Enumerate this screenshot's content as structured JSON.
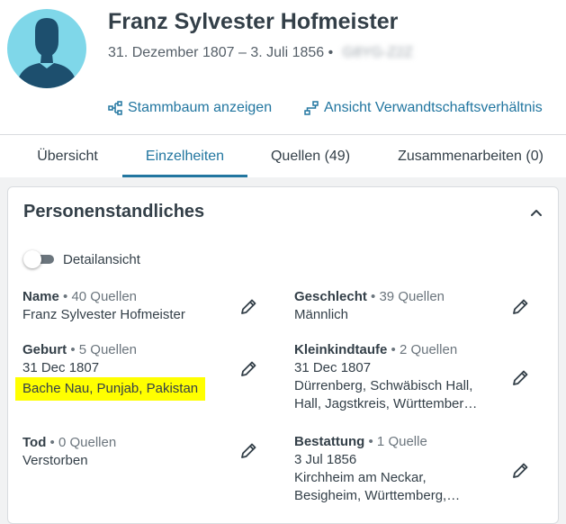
{
  "person": {
    "name": "Franz Sylvester Hofmeister",
    "dates": "31. Dezember 1807 – 3. Juli 1856 •",
    "id": "G8YG-Z2Z"
  },
  "actions": {
    "tree": "Stammbaum anzeigen",
    "relationship": "Ansicht Verwandtschaftsverhältnis"
  },
  "tabs": [
    {
      "label": "Übersicht"
    },
    {
      "label": "Einzelheiten"
    },
    {
      "label": "Quellen (49)"
    },
    {
      "label": "Zusammenarbeiten (0)"
    }
  ],
  "active_tab": "Einzelheiten",
  "section": {
    "title": "Personenstandliches",
    "toggle_label": "Detailansicht",
    "toggle_on": false
  },
  "fields": {
    "name": {
      "label": "Name",
      "sources": "• 40 Quellen",
      "lines": [
        "Franz Sylvester Hofmeister"
      ]
    },
    "gender": {
      "label": "Geschlecht",
      "sources": "• 39 Quellen",
      "lines": [
        "Männlich"
      ]
    },
    "birth": {
      "label": "Geburt",
      "sources": "• 5 Quellen",
      "lines": [
        "31 Dec 1807",
        "Bache Nau, Punjab, Pakistan"
      ]
    },
    "christening": {
      "label": "Kleinkindtaufe",
      "sources": "• 2 Quellen",
      "lines": [
        "31 Dec 1807",
        "Dürrenberg, Schwäbisch Hall,",
        "Hall, Jagstkreis, Württember…"
      ]
    },
    "death": {
      "label": "Tod",
      "sources": "• 0 Quellen",
      "lines": [
        "Verstorben"
      ]
    },
    "burial": {
      "label": "Bestattung",
      "sources": "• 1 Quelle",
      "lines": [
        "3 Jul 1856",
        "Kirchheim am Neckar,",
        "Besigheim, Württemberg,…"
      ]
    }
  },
  "colors": {
    "accent": "#2276a0",
    "highlight": "#ffff00",
    "avatar_bg": "#7fd7e9",
    "avatar_fg": "#1d4f6e"
  }
}
